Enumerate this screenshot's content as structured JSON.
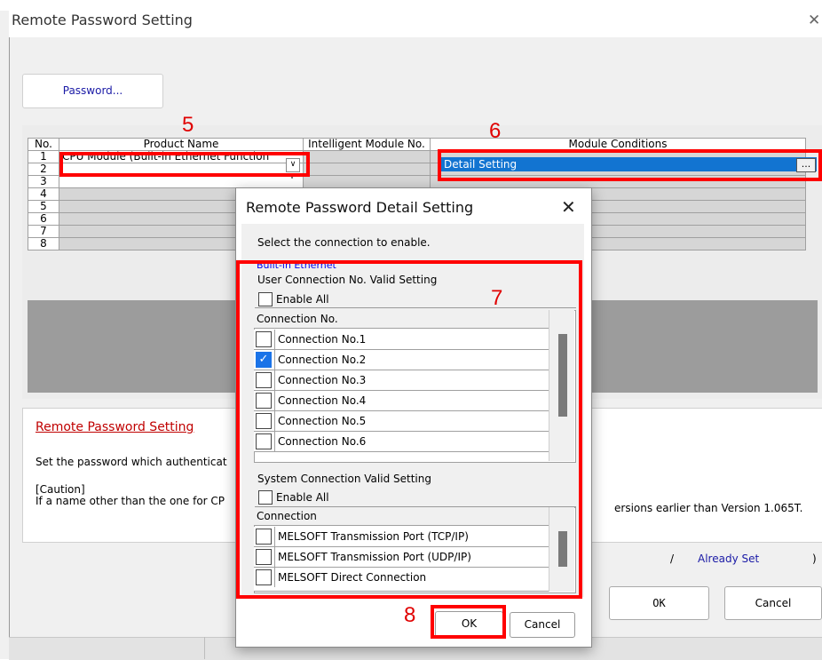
{
  "window": {
    "title": "Remote Password Setting",
    "close_glyph": "✕",
    "password_button": "Password...",
    "grid": {
      "headers": [
        "No.",
        "Product Name",
        "Intelligent Module No.",
        "Module Conditions"
      ],
      "rows": [
        {
          "no": "1",
          "product": "CPU Module (Built-in Ethernet Function",
          "conditions": "Detail Setting"
        },
        {
          "no": "2",
          "product": ""
        },
        {
          "no": "3",
          "product": ""
        },
        {
          "no": "4",
          "product": ""
        },
        {
          "no": "5",
          "product": ""
        },
        {
          "no": "6",
          "product": ""
        },
        {
          "no": "7",
          "product": ""
        },
        {
          "no": "8",
          "product": ""
        }
      ],
      "detail_button": "...",
      "dropdown_glyph": "∨"
    },
    "info": {
      "title": "Remote Password Setting",
      "text": "Set the password which authenticat",
      "caution_label": "[Caution]",
      "caution_text": "If a name other than the one for CP",
      "caution_text_right": "ersions earlier than Version 1.065T."
    },
    "status": {
      "slash": "/",
      "already_set": "Already Set",
      "paren": ")"
    },
    "ok": "OK",
    "cancel": "Cancel"
  },
  "dialog": {
    "title": "Remote Password Detail Setting",
    "close_glyph": "✕",
    "prompt": "Select the connection to enable.",
    "builtin_label": "Built-in Ethernet",
    "user_section": {
      "label": "User Connection No. Valid Setting",
      "enable_all": "Enable All",
      "column_header": "Connection No.",
      "items": [
        {
          "label": "Connection No.1",
          "checked": false
        },
        {
          "label": "Connection No.2",
          "checked": true
        },
        {
          "label": "Connection No.3",
          "checked": false
        },
        {
          "label": "Connection No.4",
          "checked": false
        },
        {
          "label": "Connection No.5",
          "checked": false
        },
        {
          "label": "Connection No.6",
          "checked": false
        }
      ]
    },
    "system_section": {
      "label": "System Connection Valid Setting",
      "enable_all": "Enable All",
      "column_header": "Connection",
      "items": [
        {
          "label": "MELSOFT Transmission Port (TCP/IP)",
          "checked": false
        },
        {
          "label": "MELSOFT Transmission Port (UDP/IP)",
          "checked": false
        },
        {
          "label": "MELSOFT Direct Connection",
          "checked": false
        }
      ]
    },
    "ok": "OK",
    "cancel": "Cancel",
    "check_glyph": "✓"
  },
  "annotations": {
    "n5": "5",
    "n6": "6",
    "n7": "7",
    "n8": "8",
    "color": "#ff0000"
  }
}
